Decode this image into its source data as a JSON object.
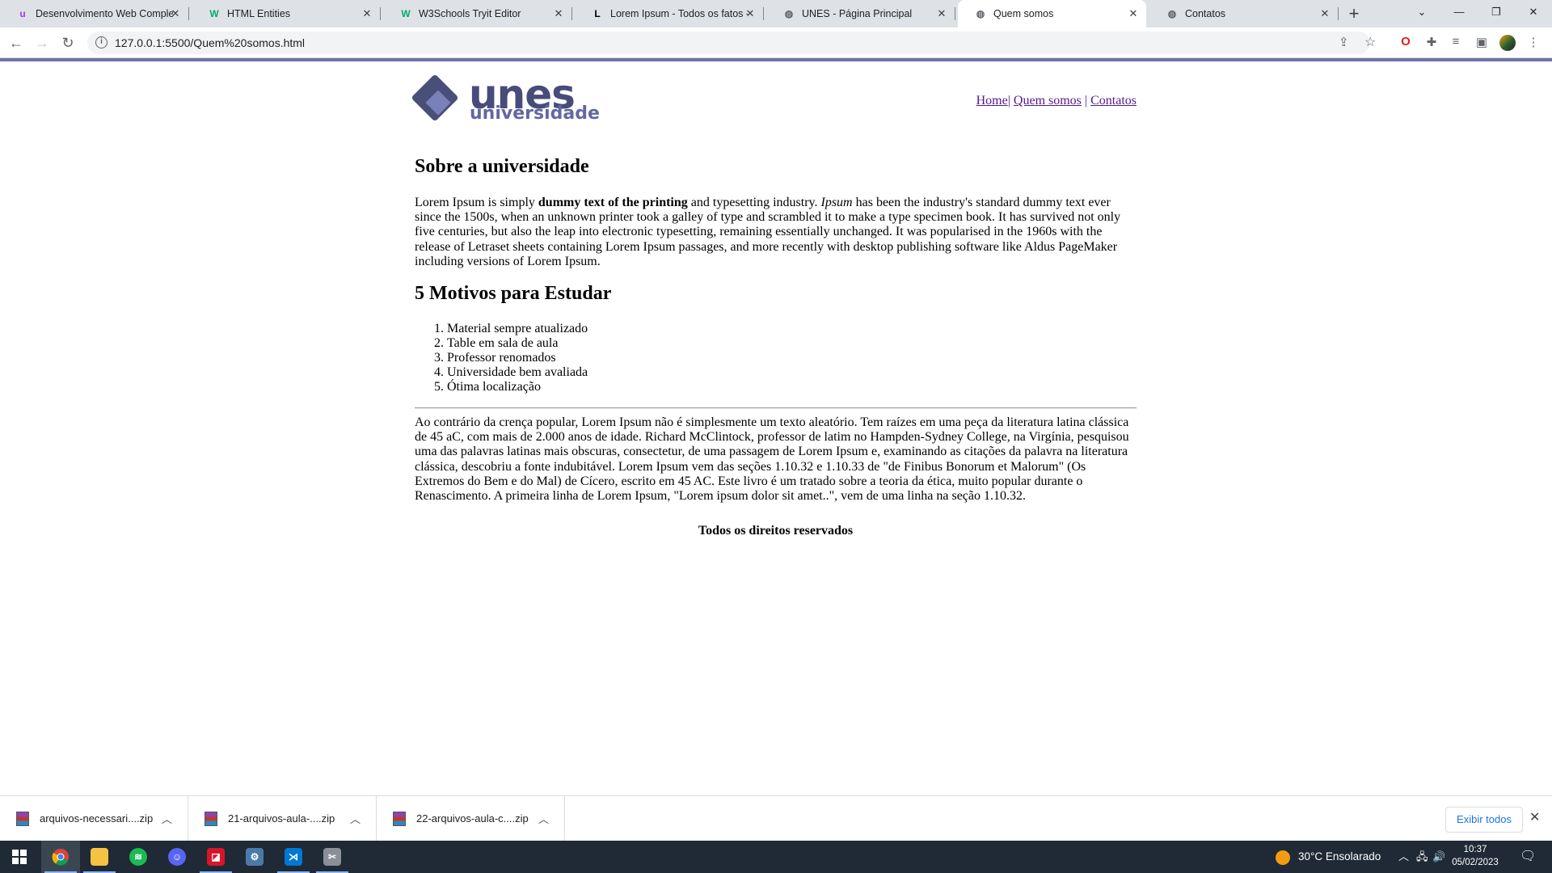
{
  "browser": {
    "tabs": [
      {
        "title": "Desenvolvimento Web Completo",
        "icon": "udemy-icon",
        "icon_glyph": "u",
        "icon_color": "#a435f0"
      },
      {
        "title": "HTML Entities",
        "icon": "w3schools-icon",
        "icon_glyph": "W",
        "icon_color": "#04aa6d"
      },
      {
        "title": "W3Schools Tryit Editor",
        "icon": "w3schools-icon",
        "icon_glyph": "W",
        "icon_color": "#04aa6d"
      },
      {
        "title": "Lorem Ipsum - Todos os fatos - L",
        "icon": "lorem-icon",
        "icon_glyph": "L",
        "icon_color": "#000000"
      },
      {
        "title": "UNES - Página Principal",
        "icon": "globe-icon",
        "icon_glyph": "◍",
        "icon_color": "#5f6368"
      },
      {
        "title": "Quem somos",
        "icon": "globe-icon",
        "icon_glyph": "◍",
        "icon_color": "#5f6368",
        "active": true
      },
      {
        "title": "Contatos",
        "icon": "globe-icon",
        "icon_glyph": "◍",
        "icon_color": "#5f6368"
      }
    ],
    "url": "127.0.0.1:5500/Quem%20somos.html"
  },
  "page": {
    "logo": {
      "word": "unes",
      "subword": "universidade"
    },
    "menu": {
      "home": "Home",
      "quem_somos": "Quem somos",
      "contatos": "Contatos",
      "sep": "|"
    },
    "about": {
      "heading": "Sobre a universidade",
      "p_pre": "Lorem Ipsum is simply ",
      "p_bold": "dummy text of the printing",
      "p_mid": " and typesetting industry. ",
      "p_italic": "Ipsum",
      "p_post": " has been the industry's standard dummy text ever since the 1500s, when an unknown printer took a galley of type and scrambled it to make a type specimen book. It has survived not only five centuries, but also the leap into electronic typesetting, remaining essentially unchanged. It was popularised in the 1960s with the release of Letraset sheets containing Lorem Ipsum passages, and more recently with desktop publishing software like Aldus PageMaker including versions of Lorem Ipsum."
    },
    "reasons": {
      "heading": "5 Motivos para Estudar",
      "items": [
        "Material sempre atualizado",
        "Table em sala de aula",
        "Professor renomados",
        "Universidade bem avaliada",
        "Ótima localização"
      ]
    },
    "history": "Ao contrário da crença popular, Lorem Ipsum não é simplesmente um texto aleatório. Tem raízes em uma peça da literatura latina clássica de 45 aC, com mais de 2.000 anos de idade. Richard McClintock, professor de latim no Hampden-Sydney College, na Virgínia, pesquisou uma das palavras latinas mais obscuras, consectetur, de uma passagem de Lorem Ipsum e, examinando as citações da palavra na literatura clássica, descobriu a fonte indubitável. Lorem Ipsum vem das seções 1.10.32 e 1.10.33 de \"de Finibus Bonorum et Malorum\" (Os Extremos do Bem e do Mal) de Cícero, escrito em 45 AC. Este livro é um tratado sobre a teoria da ética, muito popular durante o Renascimento. A primeira linha de Lorem Ipsum, \"Lorem ipsum dolor sit amet..\", vem de uma linha na seção 1.10.32.",
    "footer": "Todos os direitos reservados"
  },
  "downloads": {
    "items": [
      "arquivos-necessari....zip",
      "21-arquivos-aula-....zip",
      "22-arquivos-aula-c....zip"
    ],
    "show_all": "Exibir todos"
  },
  "taskbar": {
    "weather": "30°C  Ensolarado",
    "time": "10:37",
    "date": "05/02/2023"
  },
  "colors": {
    "accent": "#6c74a8",
    "logo": "#474c7a",
    "link_visited": "#551a8b"
  }
}
